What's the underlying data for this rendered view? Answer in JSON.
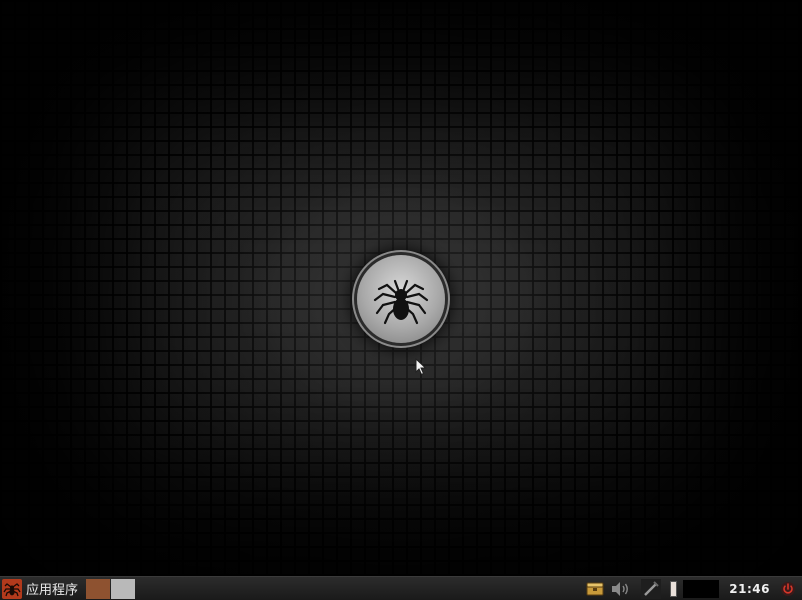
{
  "desktop": {
    "logo_icon": "spider-logo-icon"
  },
  "taskbar": {
    "menu_icon": "spider-menu-icon",
    "menu_label": "应用程序",
    "workspaces": [
      {
        "name": "workspace-1",
        "color": "#8e5230"
      },
      {
        "name": "workspace-2",
        "color": "#b9b9b9"
      }
    ],
    "tray_icons": [
      "package-manager-icon",
      "volume-icon",
      "network-icon",
      "battery-icon"
    ],
    "clock": "21:46",
    "power_icon": "power-icon"
  }
}
